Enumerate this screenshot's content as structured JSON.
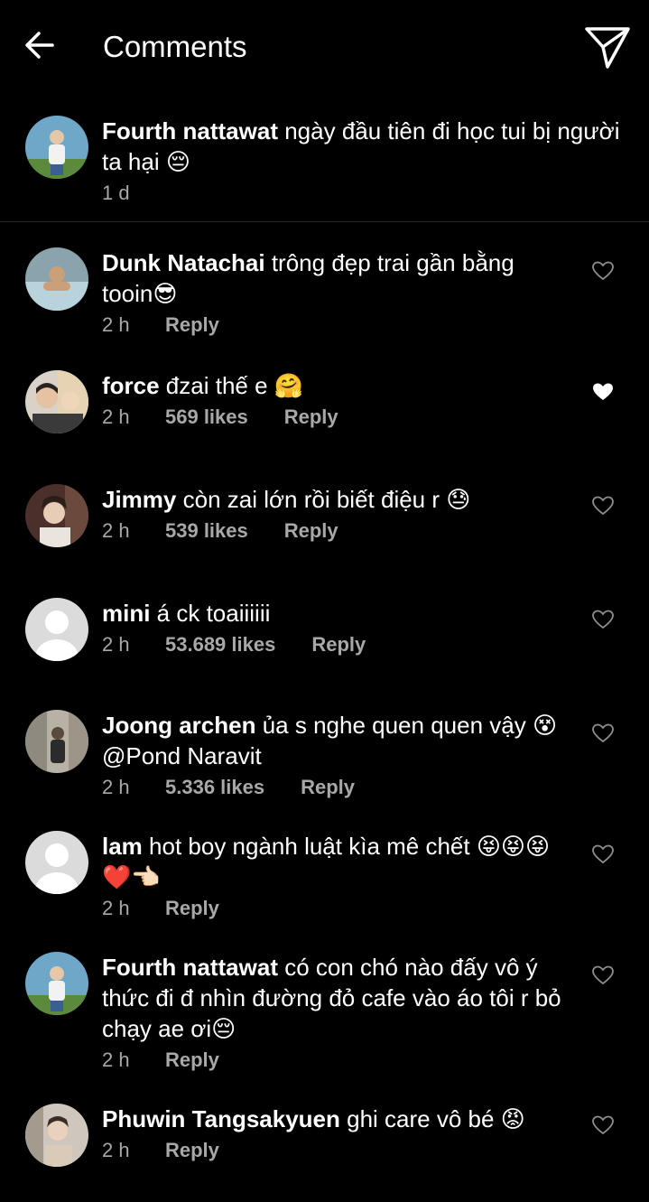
{
  "header": {
    "title": "Comments",
    "back_icon": "arrow-left-icon",
    "send_icon": "paper-plane-icon"
  },
  "caption": {
    "username": "Fourth nattawat",
    "text": " ngày đầu tiên đi học tui bị người ta hại 😔",
    "time": "1 d"
  },
  "comments": [
    {
      "username": "Dunk Natachai",
      "text": " trông đẹp trai gần bằng tooin😎",
      "time": "2 h",
      "likes": "",
      "reply": "Reply",
      "liked": false
    },
    {
      "username": "force",
      "text": " đzai thế e 🤗",
      "time": "2 h",
      "likes": "569 likes",
      "reply": "Reply",
      "liked": true
    },
    {
      "username": "Jimmy",
      "text": " còn zai lớn rồi biết điệu r 😓",
      "time": "2 h",
      "likes": "539 likes",
      "reply": "Reply",
      "liked": false
    },
    {
      "username": "mini",
      "text": " á ck toaiiiiii",
      "time": "2 h",
      "likes": "53.689 likes",
      "reply": "Reply",
      "liked": false
    },
    {
      "username": "Joong archen",
      "text": " ủa s nghe quen quen vậy 😵 @Pond Naravit",
      "time": "2 h",
      "likes": "5.336 likes",
      "reply": "Reply",
      "liked": false
    },
    {
      "username": "lam",
      "text": " hot boy ngành luật kìa mê chết 😝😝😝❤️👈🏻",
      "time": "2 h",
      "likes": "",
      "reply": "Reply",
      "liked": false
    },
    {
      "username": "Fourth nattawat",
      "text": " có con chó nào đấy vô ý thức đi đ nhìn đường đỏ cafe vào áo tôi r bỏ chạy ae ơi😔",
      "time": "2 h",
      "likes": "",
      "reply": "Reply",
      "liked": false
    },
    {
      "username": "Phuwin Tangsakyuen",
      "text": " ghi care vô bé 😡",
      "time": "2 h",
      "likes": "",
      "reply": "Reply",
      "liked": false
    }
  ],
  "colors": {
    "background": "#000000",
    "text": "#ffffff",
    "secondary": "#a8a8a8",
    "divider": "#262626"
  }
}
